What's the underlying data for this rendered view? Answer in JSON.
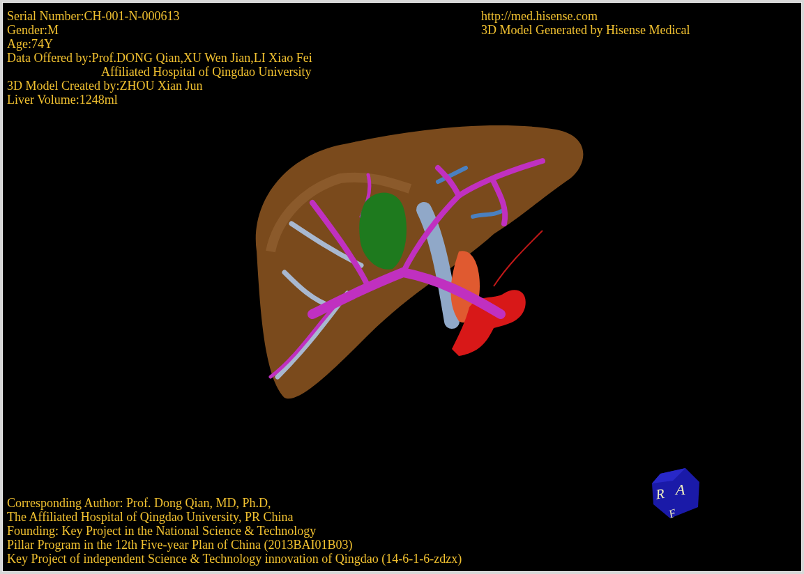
{
  "patient_info": [
    {
      "kind": "line",
      "text": "Serial Number:CH-001-N-000613"
    },
    {
      "kind": "line",
      "text": "Gender:M"
    },
    {
      "kind": "line",
      "text": "Age:74Y"
    },
    {
      "kind": "line",
      "text": "Data Offered by:Prof.DONG Qian,XU Wen Jian,LI Xiao Fei"
    },
    {
      "kind": "continuation",
      "text": "Affiliated Hospital of Qingdao University"
    },
    {
      "kind": "line",
      "text": "3D Model Created by:ZHOU Xian Jun"
    },
    {
      "kind": "line",
      "text": "Liver Volume:1248ml"
    }
  ],
  "producer_info": [
    "http://med.hisense.com",
    "3D Model Generated by Hisense Medical"
  ],
  "credits": [
    "Corresponding Author: Prof. Dong Qian, MD, Ph.D,",
    "The Affiliated Hospital of Qingdao University, PR China",
    "Founding: Key Project in the National Science & Technology",
    "Pillar Program in the 12th Five-year Plan of China (2013BAI01B03)",
    "Key Project of independent Science & Technology innovation of Qingdao (14-6-1-6-zdzx)"
  ],
  "orientation_cube": {
    "labels": [
      "R",
      "A",
      "F"
    ]
  }
}
